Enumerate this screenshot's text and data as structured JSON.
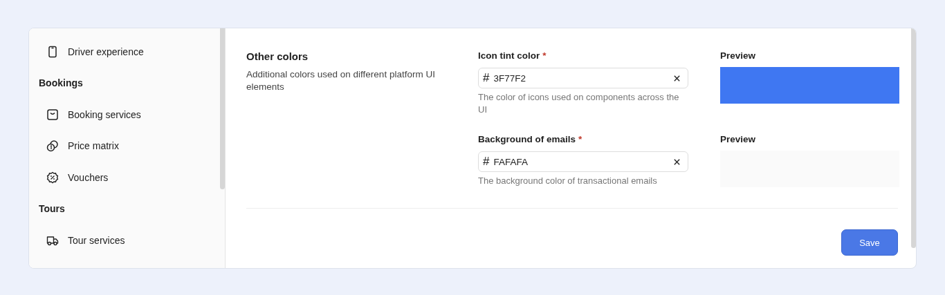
{
  "sidebar": {
    "items": [
      {
        "kind": "phone",
        "label": "Driver experience"
      },
      {
        "kind": "header",
        "label": "Bookings"
      },
      {
        "kind": "bag",
        "label": "Booking services"
      },
      {
        "kind": "coins",
        "label": "Price matrix"
      },
      {
        "kind": "discount",
        "label": "Vouchers"
      },
      {
        "kind": "header",
        "label": "Tours"
      },
      {
        "kind": "truck",
        "label": "Tour services"
      }
    ]
  },
  "section": {
    "title": "Other colors",
    "description": "Additional colors used on different platform UI elements"
  },
  "fields": [
    {
      "label": "Icon tint color",
      "required_mark": "*",
      "prefix": "#",
      "value": "3F77F2",
      "hint": "The color of icons used on components across the UI",
      "preview_label": "Preview"
    },
    {
      "label": "Background of emails",
      "required_mark": "*",
      "prefix": "#",
      "value": "FAFAFA",
      "hint": "The background color of transactional emails",
      "preview_label": "Preview"
    }
  ],
  "save_button": "Save"
}
